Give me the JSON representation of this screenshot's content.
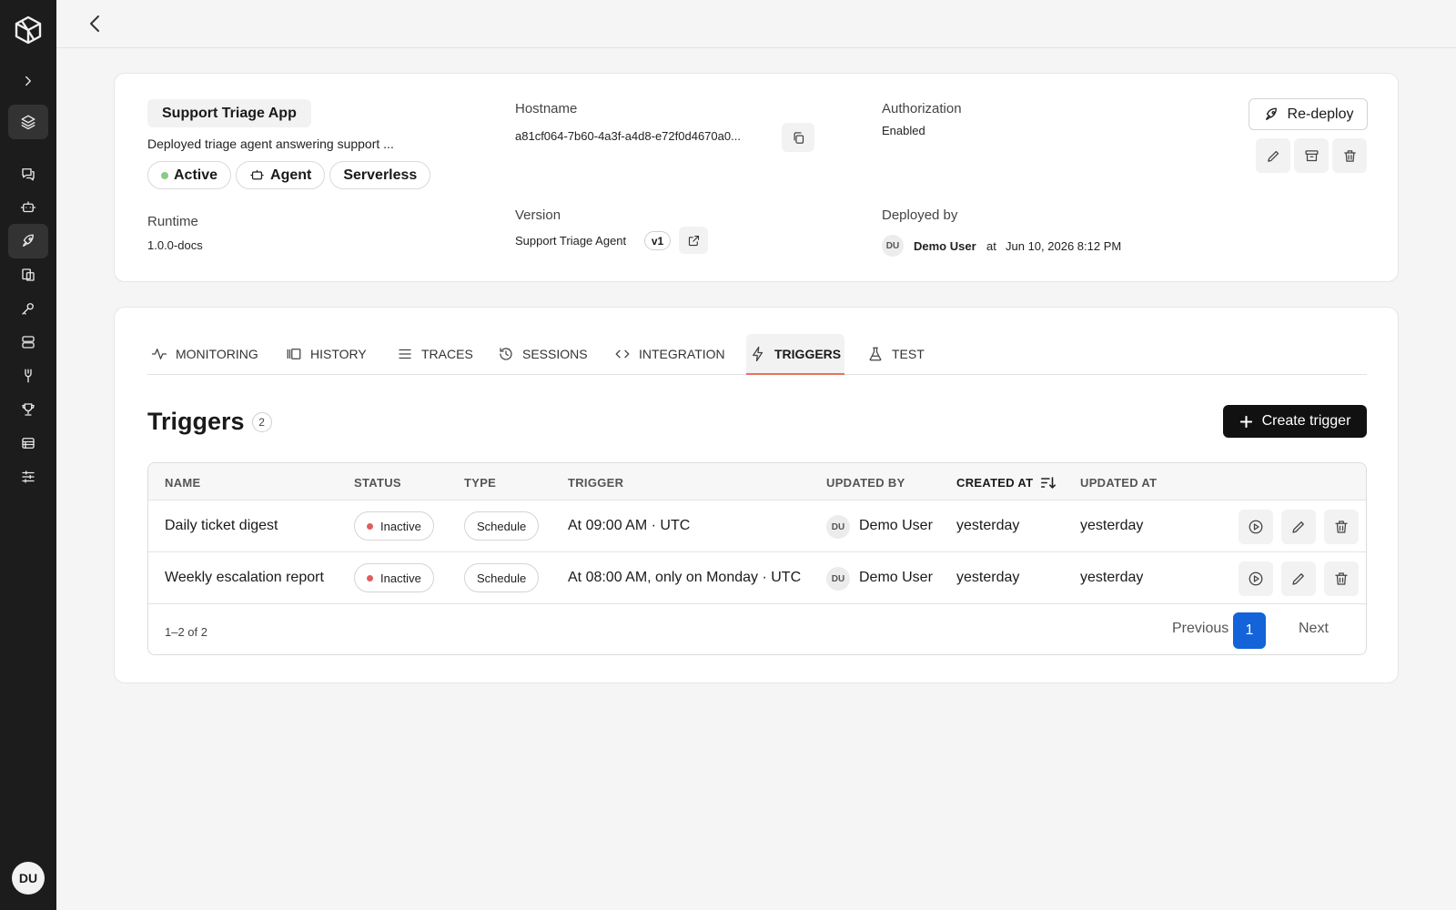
{
  "app": {
    "title": "Support Triage App",
    "description": "Deployed triage agent answering support ...",
    "chips": {
      "status": "Active",
      "type": "Agent",
      "mode": "Serverless"
    }
  },
  "runtime": {
    "label": "Runtime",
    "value": "1.0.0-docs"
  },
  "hostname": {
    "label": "Hostname",
    "value": "a81cf064-7b60-4a3f-a4d8-e72f0d4670a0..."
  },
  "version": {
    "label": "Version",
    "value": "Support Triage Agent",
    "badge": "v1"
  },
  "authorization": {
    "label": "Authorization",
    "value": "Enabled"
  },
  "deployed_by": {
    "label": "Deployed by",
    "avatar": "DU",
    "user": "Demo User",
    "at_word": "at",
    "date": "Jun 10, 2026 8:12 PM"
  },
  "actions": {
    "redeploy": "Re-deploy"
  },
  "tabs": [
    {
      "label": "MONITORING",
      "icon": "activity-icon"
    },
    {
      "label": "HISTORY",
      "icon": "history-icon"
    },
    {
      "label": "TRACES",
      "icon": "list-icon"
    },
    {
      "label": "SESSIONS",
      "icon": "clock-icon"
    },
    {
      "label": "INTEGRATION",
      "icon": "code-icon"
    },
    {
      "label": "TRIGGERS",
      "icon": "bolt-icon"
    },
    {
      "label": "TEST",
      "icon": "flask-icon"
    }
  ],
  "active_tab": "TRIGGERS",
  "triggers": {
    "title": "Triggers",
    "count": "2",
    "create_label": "Create trigger",
    "columns": {
      "name": "NAME",
      "status": "STATUS",
      "type": "TYPE",
      "trigger": "TRIGGER",
      "updated_by": "UPDATED BY",
      "created_at": "CREATED AT",
      "updated_at": "UPDATED AT"
    },
    "rows": [
      {
        "name": "Daily ticket digest",
        "status": "Inactive",
        "type": "Schedule",
        "trigger": "At 09:00 AM · UTC",
        "avatar": "DU",
        "updated_by": "Demo User",
        "created_at": "yesterday",
        "updated_at": "yesterday"
      },
      {
        "name": "Weekly escalation report",
        "status": "Inactive",
        "type": "Schedule",
        "trigger": "At 08:00 AM, only on Monday · UTC",
        "avatar": "DU",
        "updated_by": "Demo User",
        "created_at": "yesterday",
        "updated_at": "yesterday"
      }
    ],
    "pagination": {
      "info": "1–2 of 2",
      "previous": "Previous",
      "current": "1",
      "next": "Next"
    }
  },
  "user": {
    "initials": "DU"
  },
  "colors": {
    "sidebar": "#1c1c1c",
    "accent_tab": "#e8735a",
    "primary": "#1463d8",
    "active_dot": "#8cc987",
    "inactive_dot": "#e35d5d"
  }
}
